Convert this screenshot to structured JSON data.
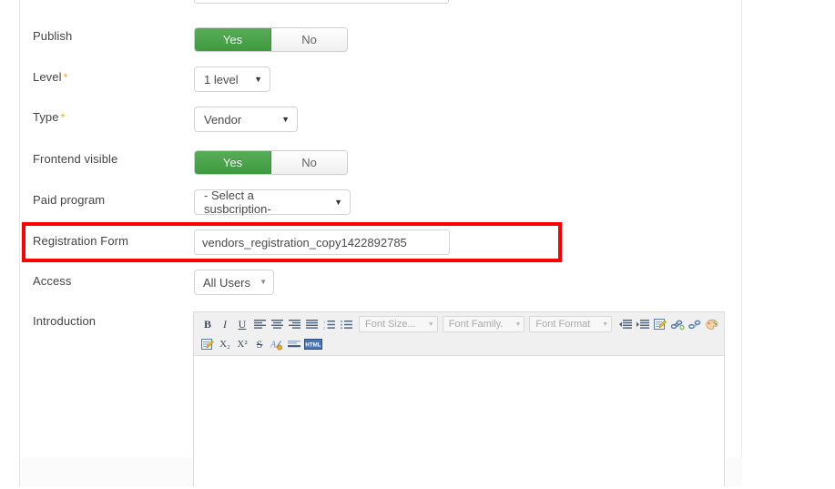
{
  "form": {
    "rows": [
      {
        "label": "Publish",
        "required": false,
        "control": "toggle",
        "options": [
          "Yes",
          "No"
        ],
        "selected": "Yes"
      },
      {
        "label": "Level",
        "required": true,
        "control": "select",
        "value": "1 level"
      },
      {
        "label": "Type",
        "required": true,
        "control": "select",
        "value": "Vendor"
      },
      {
        "label": "Frontend visible",
        "required": false,
        "control": "toggle",
        "options": [
          "Yes",
          "No"
        ],
        "selected": "Yes"
      },
      {
        "label": "Paid program",
        "required": false,
        "control": "select",
        "value": "- Select a susbcription-"
      },
      {
        "label": "Registration Form",
        "required": false,
        "control": "text",
        "value": "vendors_registration_copy1422892785",
        "placeholder": ""
      },
      {
        "label": "Access",
        "required": false,
        "control": "select",
        "value": "All Users"
      },
      {
        "label": "Introduction",
        "required": false,
        "control": "richtext"
      }
    ],
    "required_marker": "*"
  },
  "editor": {
    "toolbar_row1": [
      {
        "name": "bold-icon",
        "glyph": "B"
      },
      {
        "name": "italic-icon",
        "glyph": "I"
      },
      {
        "name": "underline-icon",
        "glyph": "U"
      },
      {
        "name": "align-left-icon",
        "glyph": ""
      },
      {
        "name": "align-center-icon",
        "glyph": ""
      },
      {
        "name": "align-right-icon",
        "glyph": ""
      },
      {
        "name": "align-justify-icon",
        "glyph": ""
      },
      {
        "name": "ordered-list-icon",
        "glyph": ""
      },
      {
        "name": "unordered-list-icon",
        "glyph": ""
      }
    ],
    "combos": [
      {
        "name": "font-size-select",
        "label": "Font Size..."
      },
      {
        "name": "font-family-select",
        "label": "Font Family."
      },
      {
        "name": "font-format-select",
        "label": "Font Format"
      }
    ],
    "toolbar_row1_tail": [
      {
        "name": "outdent-icon",
        "glyph": ""
      },
      {
        "name": "indent-icon",
        "glyph": ""
      },
      {
        "name": "edit-source-icon",
        "glyph": ""
      },
      {
        "name": "insert-link-icon",
        "glyph": ""
      },
      {
        "name": "unlink-icon",
        "glyph": ""
      },
      {
        "name": "text-color-palette-icon",
        "glyph": ""
      }
    ],
    "toolbar_row2": [
      {
        "name": "toggle-editor-icon",
        "glyph": ""
      },
      {
        "name": "subscript-icon",
        "glyph": "X₂"
      },
      {
        "name": "superscript-icon",
        "glyph": "X²"
      },
      {
        "name": "strikethrough-icon",
        "glyph": "S"
      },
      {
        "name": "font-color-icon",
        "glyph": ""
      },
      {
        "name": "horizontal-rule-icon",
        "glyph": ""
      },
      {
        "name": "html-source-icon",
        "glyph": "HTML"
      }
    ],
    "content": ""
  },
  "highlight": {
    "target_row_label": "Registration Form",
    "color": "#fe0000"
  },
  "colors": {
    "toggle_on": "#4a9e4a",
    "required_asterisk": "#f6a623",
    "label_text": "#444444",
    "border": "#d4d4d4",
    "highlight_red": "#fe0000"
  }
}
